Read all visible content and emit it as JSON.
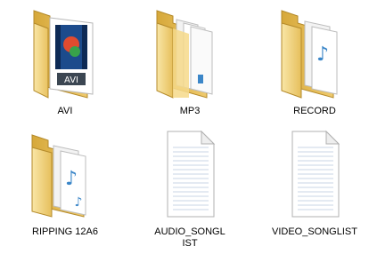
{
  "items": [
    {
      "label": "AVI",
      "icon": "folder-video-icon",
      "kind": "folder"
    },
    {
      "label": "MP3",
      "icon": "folder-documents-icon",
      "kind": "folder"
    },
    {
      "label": "RECORD",
      "icon": "folder-music-icon",
      "kind": "folder"
    },
    {
      "label": "RIPPING 12A6",
      "icon": "folder-music-icon",
      "kind": "folder"
    },
    {
      "label": "AUDIO_SONGLIST",
      "icon": "text-file-icon",
      "kind": "file"
    },
    {
      "label": "VIDEO_SONGLIST",
      "icon": "text-file-icon",
      "kind": "file"
    }
  ],
  "colors": {
    "folder_back": "#e3b950",
    "folder_front": "#f6d989",
    "paper": "#ffffff",
    "paper_line": "#c8d4e4",
    "music_note": "#3b86c8"
  }
}
